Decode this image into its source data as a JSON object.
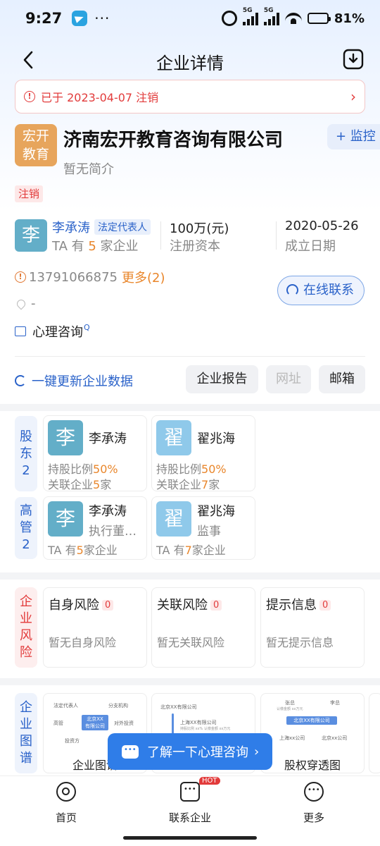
{
  "status_bar": {
    "time": "9:27",
    "dots": "···",
    "network": "5G",
    "battery": "81%",
    "battery_level": 0.81
  },
  "nav": {
    "title": "企业详情"
  },
  "banner": {
    "text": "已于 2023-04-07 注销",
    "icon": "warning-icon"
  },
  "company": {
    "logo_line1": "宏开",
    "logo_line2": "教育",
    "name": "济南宏开教育咨询有限公司",
    "intro": "暂无简介",
    "monitor_label": "+ 监控",
    "status": "注销"
  },
  "stats": {
    "rep_avatar": "李",
    "rep_name": "李承涛",
    "rep_tag": "法定代表人",
    "rep_count_prefix": "TA 有 ",
    "rep_count_num": "5",
    "rep_count_suffix": " 家企业",
    "capital_value": "100万(元)",
    "capital_label": "注册资本",
    "date_value": "2020-05-26",
    "date_label": "成立日期"
  },
  "contact": {
    "phone": "13791066875",
    "more": "更多(2)",
    "online_label": "在线联系",
    "address": "-",
    "industry": "心理咨询"
  },
  "actions": {
    "update_label": "一键更新企业数据",
    "report_label": "企业报告",
    "website_label": "网址",
    "email_label": "邮箱"
  },
  "shareholders": {
    "label_chars": [
      "股",
      "东",
      "2"
    ],
    "items": [
      {
        "avatar": "李",
        "color": "#63aec8",
        "name": "李承涛",
        "ratio_label": "持股比例",
        "ratio": "50%",
        "related_prefix": "关联企业",
        "related_num": "5",
        "related_suffix": "家"
      },
      {
        "avatar": "翟",
        "color": "#8fc9ea",
        "name": "翟兆海",
        "ratio_label": "持股比例",
        "ratio": "50%",
        "related_prefix": "关联企业",
        "related_num": "7",
        "related_suffix": "家"
      }
    ]
  },
  "executives": {
    "label_chars": [
      "高",
      "管",
      "2"
    ],
    "items": [
      {
        "avatar": "李",
        "color": "#63aec8",
        "name": "李承涛",
        "role": "执行董事兼总经理",
        "count_prefix": "TA 有",
        "count_num": "5",
        "count_suffix": "家企业"
      },
      {
        "avatar": "翟",
        "color": "#8fc9ea",
        "name": "翟兆海",
        "role": "监事",
        "count_prefix": "TA 有",
        "count_num": "7",
        "count_suffix": "家企业"
      }
    ]
  },
  "risk": {
    "label_chars": [
      "企",
      "业",
      "风",
      "险"
    ],
    "items": [
      {
        "title": "自身风险",
        "count": "0",
        "empty": "暂无自身风险"
      },
      {
        "title": "关联风险",
        "count": "0",
        "empty": "暂无关联风险"
      },
      {
        "title": "提示信息",
        "count": "0",
        "empty": "暂无提示信息"
      }
    ]
  },
  "graph": {
    "label_chars": [
      "企",
      "业",
      "图",
      "谱"
    ],
    "card1_title": "企业图谱",
    "card3_title": "股权穿透图",
    "card1": {
      "center": "北京XX\n有限公司",
      "n1": "法定代表人",
      "n2": "分支机构",
      "n3": "高管",
      "n4": "对外投资",
      "n5": "投资方"
    },
    "card2": {
      "n1": "北京XX有限公司",
      "n2": "上海XX有限公司",
      "n3": "持股比例 xx%   认缴金额 xx万元"
    },
    "card3": {
      "n1": "张总",
      "n2": "李总",
      "n3": "认缴金额 xx万元",
      "center": "北京XX有限公司",
      "n4": "上海xx公司",
      "n5": "北京xx公司"
    }
  },
  "toast": {
    "text": "了解一下心理咨询",
    "chevron": "›"
  },
  "tabs": {
    "home": "首页",
    "contact": "联系企业",
    "hot": "HOT",
    "more": "更多"
  }
}
